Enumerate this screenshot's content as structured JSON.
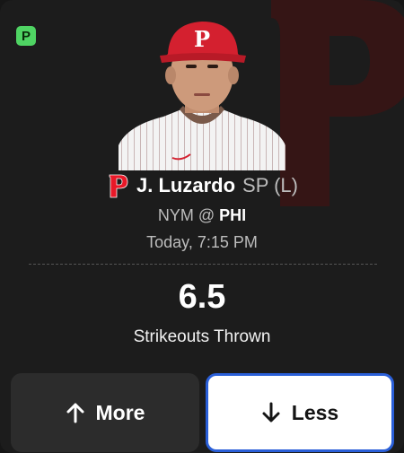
{
  "platform_badge": "P",
  "player": {
    "name": "J. Luzardo",
    "position": "SP (L)",
    "team_logo": "phillies-p-logo"
  },
  "game": {
    "away": "NYM",
    "separator": "@",
    "home": "PHI",
    "time": "Today, 7:15 PM"
  },
  "projection": {
    "line": "6.5",
    "stat": "Strikeouts Thrown"
  },
  "actions": {
    "more_label": "More",
    "less_label": "Less",
    "selected": "less"
  },
  "colors": {
    "background": "#1c1c1c",
    "badge_green": "#4fd463",
    "team_red": "#e81828",
    "selection_blue": "#2a5fd8"
  }
}
